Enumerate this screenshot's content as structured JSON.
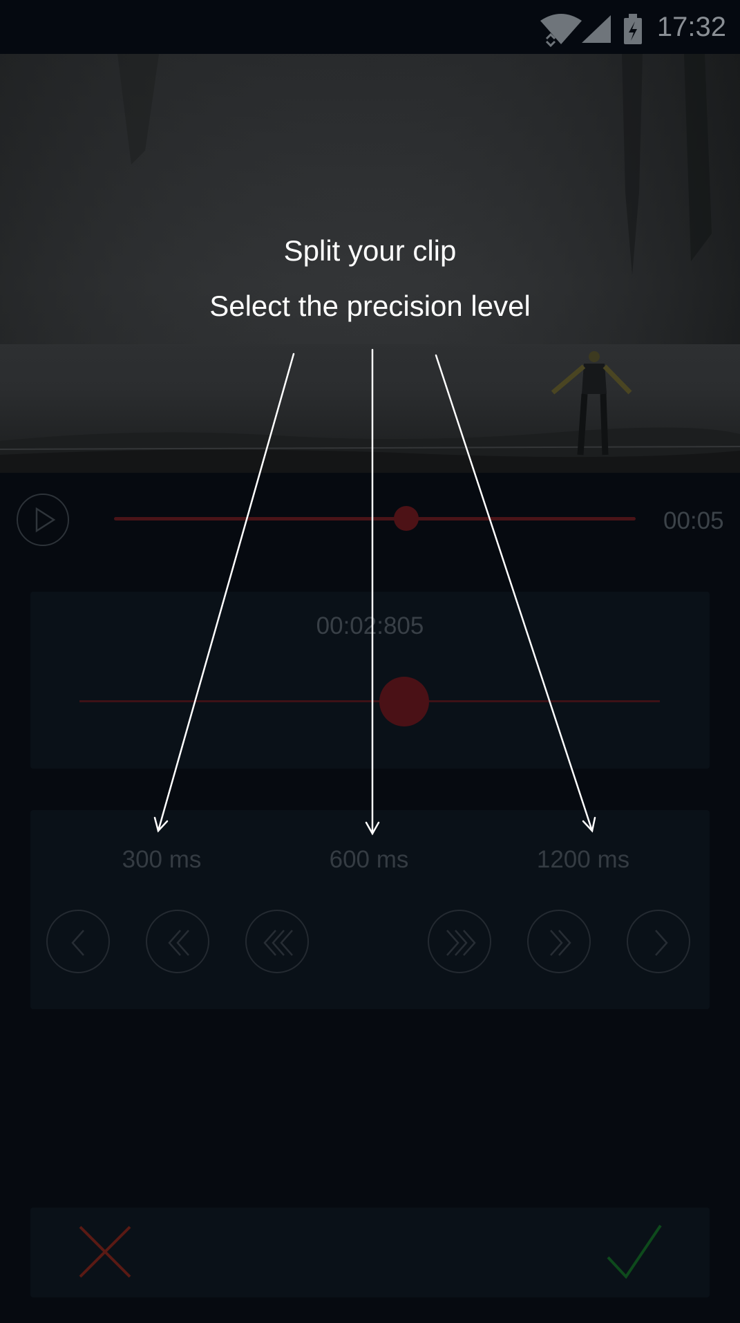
{
  "status_bar": {
    "time": "17:32",
    "icons": [
      "wifi-icon",
      "signal-icon",
      "battery-charging-icon"
    ]
  },
  "player": {
    "duration": "00:05",
    "progress_fraction": 0.56,
    "play_icon": "play-icon"
  },
  "fine_scrubber": {
    "current_time": "00:02:805",
    "position_fraction": 0.56
  },
  "precision": {
    "levels": [
      {
        "label": "300 ms"
      },
      {
        "label": "600 ms"
      },
      {
        "label": "1200 ms"
      }
    ],
    "buttons": [
      {
        "name": "step-back-300-button",
        "icon": "single-chevron-left-icon"
      },
      {
        "name": "step-back-600-button",
        "icon": "double-chevron-left-icon"
      },
      {
        "name": "step-back-1200-button",
        "icon": "triple-chevron-left-icon"
      },
      {
        "name": "step-forward-1200-button",
        "icon": "triple-chevron-right-icon"
      },
      {
        "name": "step-forward-600-button",
        "icon": "double-chevron-right-icon"
      },
      {
        "name": "step-forward-300-button",
        "icon": "single-chevron-right-icon"
      }
    ]
  },
  "actions": {
    "cancel_icon": "close-icon",
    "confirm_icon": "check-icon"
  },
  "overlay": {
    "title": "Split your clip",
    "subtitle": "Select the precision level"
  },
  "colors": {
    "accent_red": "#4d1216",
    "confirm_green": "#0e4a1c",
    "cancel_red": "#5a1a14",
    "background": "#060a10"
  }
}
